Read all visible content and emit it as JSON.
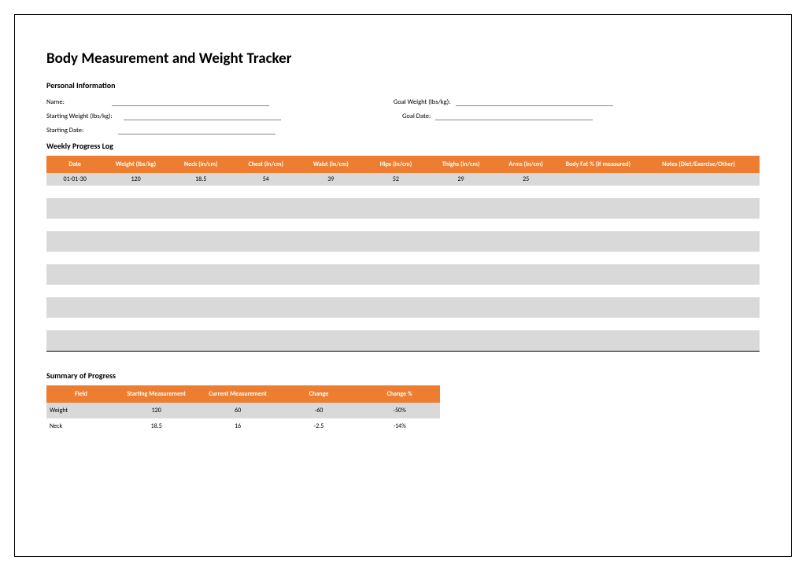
{
  "title": "Body Measurement and Weight Tracker",
  "personal": {
    "heading": "Personal Information",
    "name_label": "Name:",
    "starting_weight_label": "Starting Weight (lbs/kg):",
    "starting_date_label": "Starting Date:",
    "goal_weight_label": "Goal Weight (lbs/kg):",
    "goal_date_label": "Goal Date:"
  },
  "weekly": {
    "heading": "Weekly Progress Log",
    "headers": {
      "date": "Date",
      "weight": "Weight (lbs/kg)",
      "neck": "Neck (in/cm)",
      "chest": "Chest (in/cm)",
      "waist": "Waist (in/cm)",
      "hips": "Hips (in/cm)",
      "thighs": "Thighs (in/cm)",
      "arms": "Arms (in/cm)",
      "bodyfat": "Body Fat % (if measured)",
      "notes": "Notes (Diet/Exercise/Other)"
    },
    "row1": {
      "date": "01-01-30",
      "weight": "120",
      "neck": "18.5",
      "chest": "54",
      "waist": "39",
      "hips": "52",
      "thighs": "29",
      "arms": "25",
      "bodyfat": "",
      "notes": ""
    }
  },
  "summary": {
    "heading": "Summary of Progress",
    "headers": {
      "field": "Field",
      "start": "Starting Measurement",
      "current": "Current Measurement",
      "change": "Change",
      "changep": "Change %"
    },
    "rows": [
      {
        "field": "Weight",
        "start": "120",
        "current": "60",
        "change": "-60",
        "changep": "-50%"
      },
      {
        "field": "Neck",
        "start": "18.5",
        "current": "16",
        "change": "-2.5",
        "changep": "-14%"
      }
    ]
  }
}
